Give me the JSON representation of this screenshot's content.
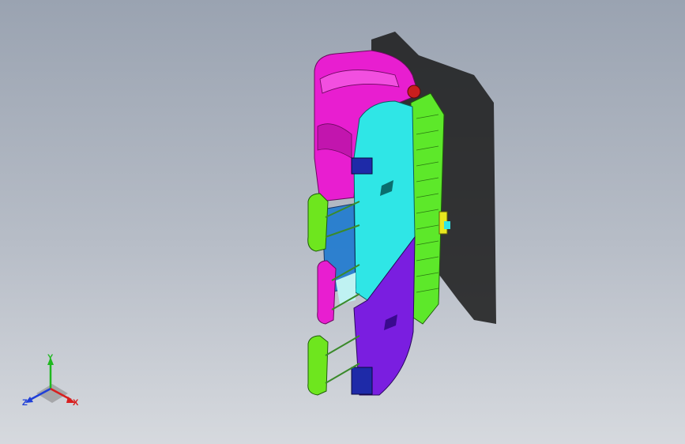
{
  "viewport": {
    "background_top": "#9aa3b1",
    "background_bottom": "#d6d9de"
  },
  "model": {
    "part_colors": {
      "backrest": "#e81ed0",
      "center_housing": "#2fe6e6",
      "lower_housing": "#7a1ee0",
      "rail": "#5de82a",
      "handles": "#6ee61e",
      "window": "#1e7ad0",
      "clip": "#1e2aa8"
    }
  },
  "triad": {
    "y_label": "Y",
    "z_label": "Z",
    "x_label": "X",
    "colors": {
      "y": "#1fb81f",
      "z": "#1f3fd8",
      "x": "#d81f1f"
    }
  }
}
